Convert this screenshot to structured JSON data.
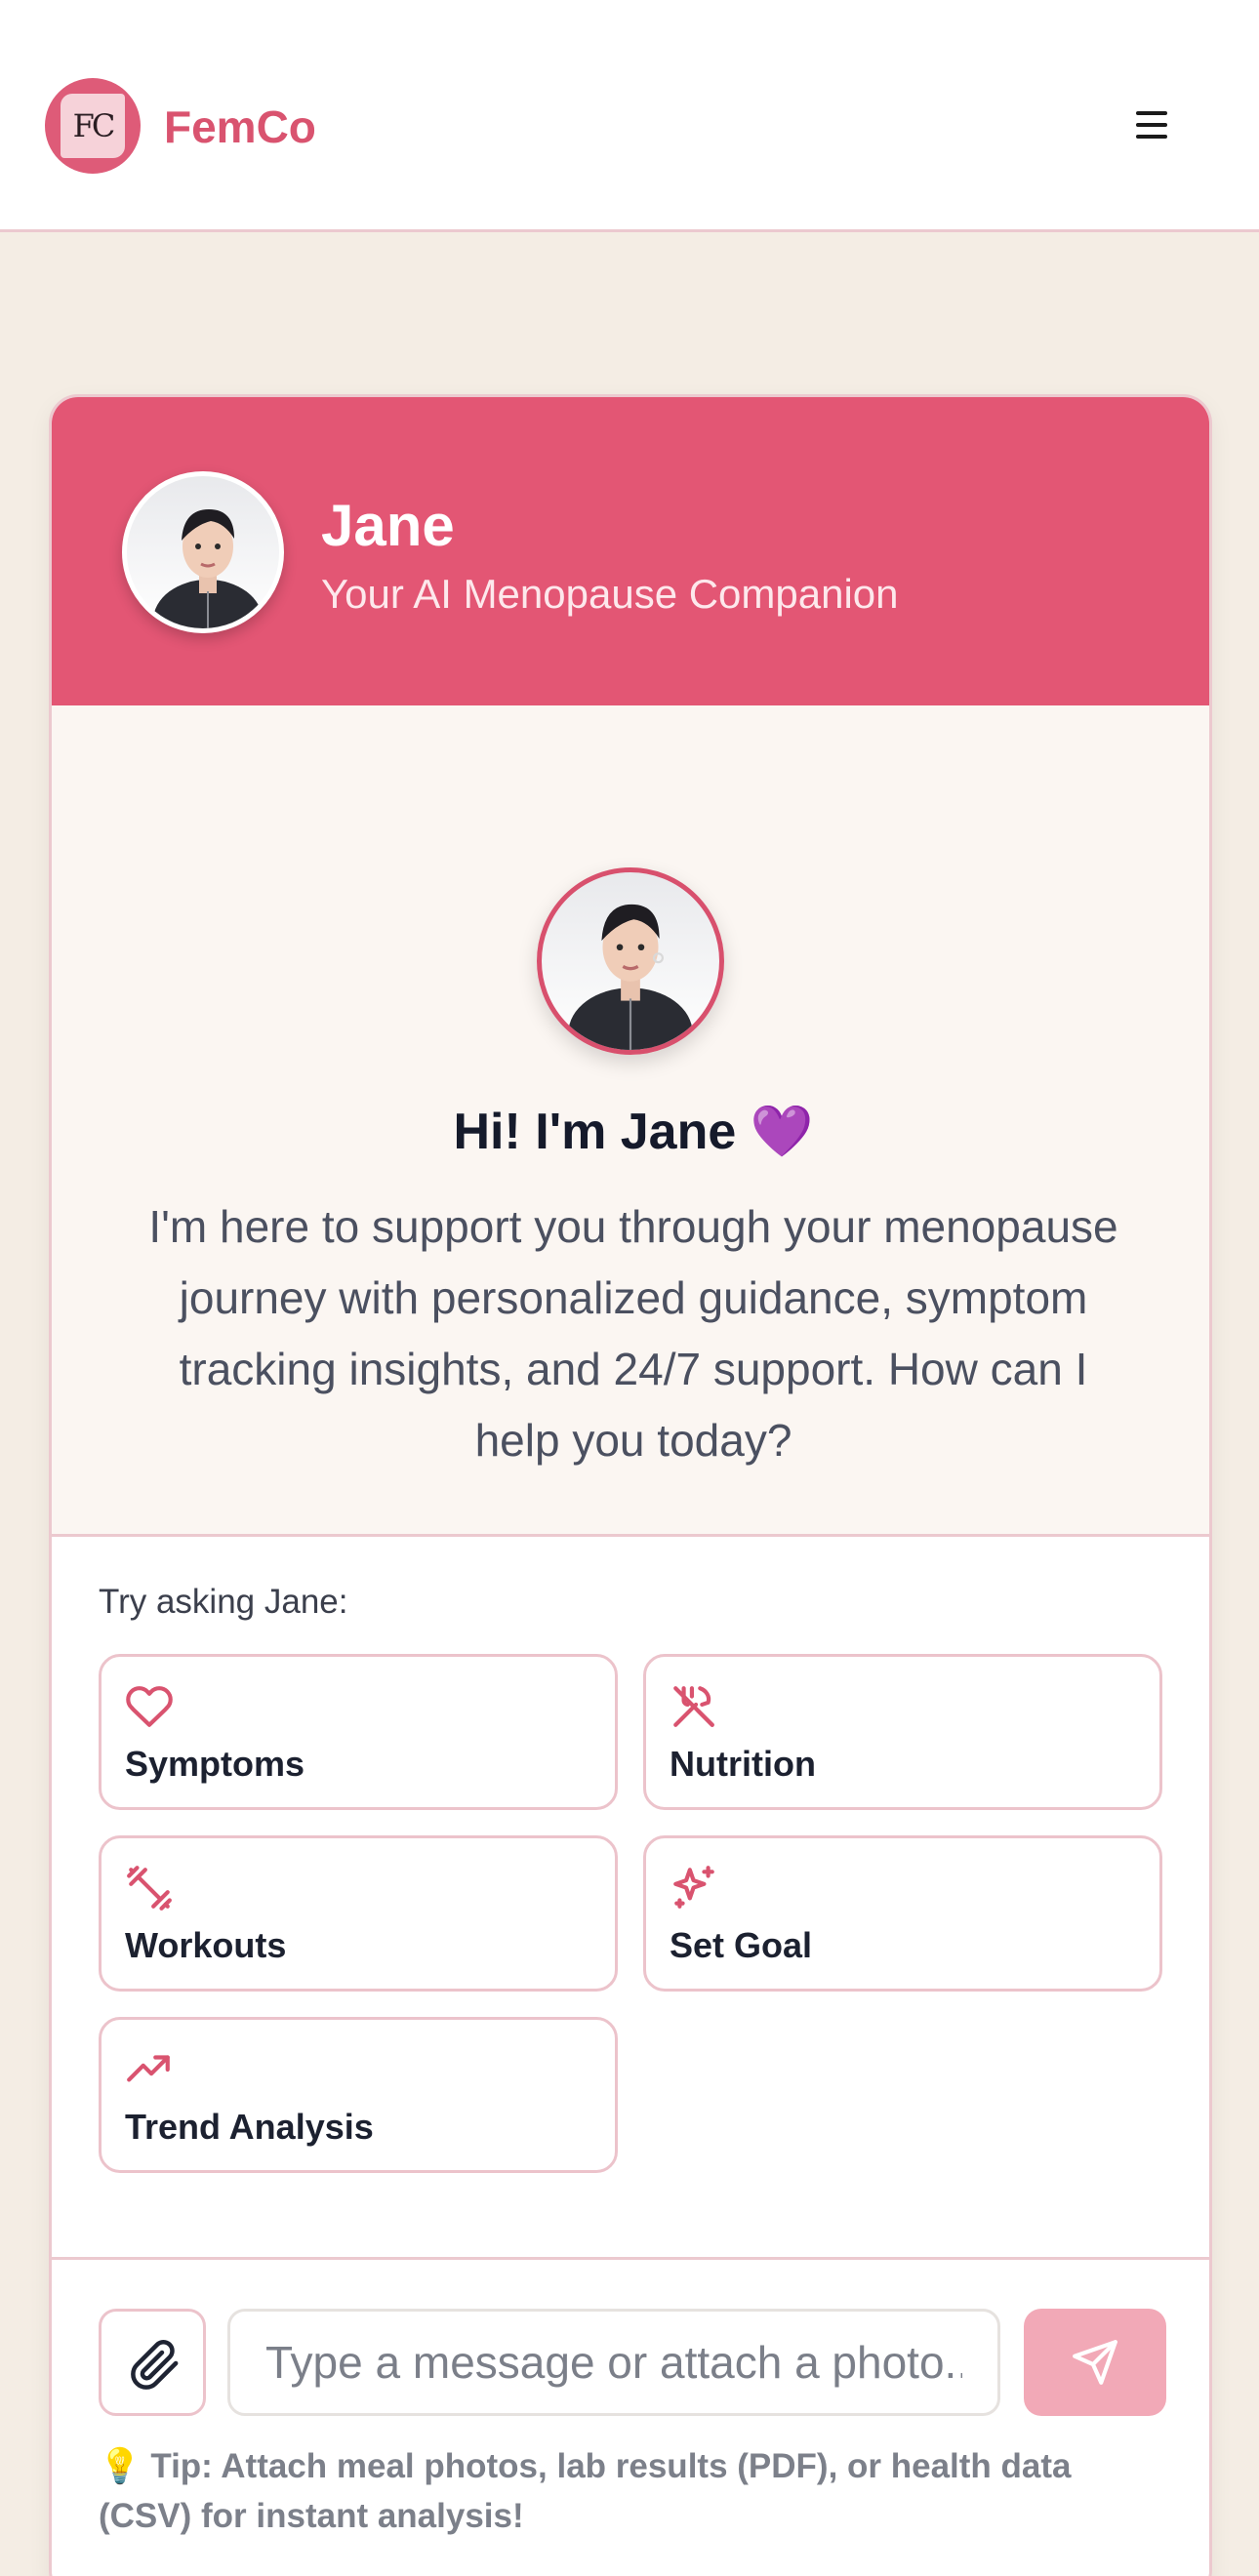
{
  "header": {
    "logo_text": "FC",
    "brand": "FemCo"
  },
  "chat": {
    "assistant_name": "Jane",
    "assistant_subtitle": "Your AI Menopause Companion",
    "welcome_title": "Hi! I'm Jane 💜",
    "welcome_text": "I'm here to support you through your menopause journey with personalized guidance, symptom tracking insights, and 24/7 support. How can I help you today?"
  },
  "suggestions": {
    "label": "Try asking Jane:",
    "items": [
      {
        "label": "Symptoms",
        "icon": "heart-icon"
      },
      {
        "label": "Nutrition",
        "icon": "utensils-icon"
      },
      {
        "label": "Workouts",
        "icon": "dumbbell-icon"
      },
      {
        "label": "Set Goal",
        "icon": "sparkles-icon"
      },
      {
        "label": "Trend Analysis",
        "icon": "trending-up-icon"
      }
    ]
  },
  "composer": {
    "placeholder": "Type a message or attach a photo...",
    "tip_icon": "💡",
    "tip": "Tip: Attach meal photos, lab results (PDF), or health data (CSV) for instant analysis!"
  },
  "colors": {
    "brand": "#e35674",
    "background": "#f4ede4",
    "send_button": "#f2a9b7"
  }
}
